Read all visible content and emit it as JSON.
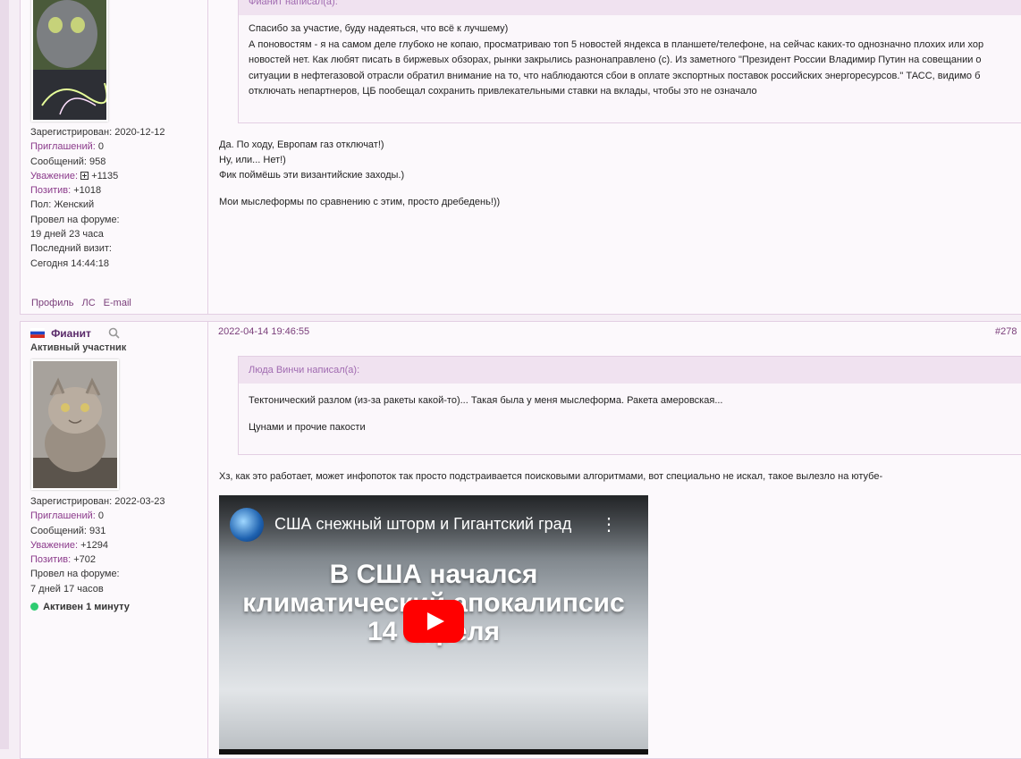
{
  "post1": {
    "registered": "Зарегистрирован: 2020-12-12",
    "invited_label": "Приглашений:",
    "invited_value": " 0",
    "posts": "Сообщений: 958",
    "respect_label": "Уважение:",
    "respect_value": " +1135",
    "positive_label": "Позитив:",
    "positive_value": " +1018",
    "gender": "Пол: Женский",
    "time_label": "Провел на форуме:",
    "time_value": "19 дней 23 часа",
    "last_visit_label": "Последний визит:",
    "last_visit_value": "Сегодня 14:44:18",
    "links": [
      "Профиль",
      "ЛС",
      "E-mail"
    ],
    "quote_author": "Фианит написал(а):",
    "quote_lines": [
      "Спасибо за участие, буду надеяться, что всё к лучшему)",
      "А поновостям - я на самом деле глубоко не копаю, просматриваю топ 5 новостей яндекса в планшете/телефоне, на сейчас каких-то однозначно плохих или хор",
      "новостей нет. Как любят писать в биржевых обзорах, рынки закрылись разнонаправлено (с). Из заметного \"Президент России Владимир Путин на совещании о",
      "ситуации в нефтегазовой отрасли обратил внимание на то, что наблюдаются сбои в оплате экспортных поставок российских энергоресурсов.\" ТАСС, видимо б",
      "отключать непартнеров, ЦБ пообещал сохранить привлекательными ставки на вклады, чтобы это не означало"
    ],
    "message_lines": [
      "Да. По ходу, Европам газ отключат!)",
      "Ну, или... Нет!)",
      "Фик поймёшь эти византийские заходы.)"
    ],
    "message_last": "Мои мыслеформы по сравнению с этим, просто дребедень!))"
  },
  "post2": {
    "username": "Фианит",
    "rank": "Активный участник",
    "registered": "Зарегистрирован: 2022-03-23",
    "invited_label": "Приглашений:",
    "invited_value": " 0",
    "posts": "Сообщений: 931",
    "respect_label": "Уважение:",
    "respect_value": " +1294",
    "positive_label": "Позитив:",
    "positive_value": " +702",
    "time_label": "Провел на форуме:",
    "time_value": "7 дней 17 часов",
    "status": "Активен 1 минуту",
    "date": "2022-04-14 19:46:55",
    "post_number": "#278",
    "quote_author": "Люда Винчи написал(а):",
    "quote_line1": "Тектонический разлом (из-за ракеты какой-то)... Такая была у меня мыслеформа. Ракета амеровская...",
    "quote_line2": "Цунами и прочие пакости",
    "message": "Хз, как это работает, может инфопоток так просто подстраивается поисковыми алгоритмами, вот специально не искал, такое вылезло на ютубе-",
    "video": {
      "title": "США снежный шторм и Гигантский град",
      "line1": "В США начался",
      "line2": "климатический апокалипсис",
      "line3": "14 апреля"
    }
  },
  "colors": {
    "accent": "#7a3e7a",
    "online": "#2ecc71",
    "youtube_red": "#ff0000"
  },
  "icons": [
    "search-icon",
    "flag-icon",
    "respect-plus-icon",
    "play-icon",
    "more-vertical-icon",
    "channel-globe-icon"
  ]
}
